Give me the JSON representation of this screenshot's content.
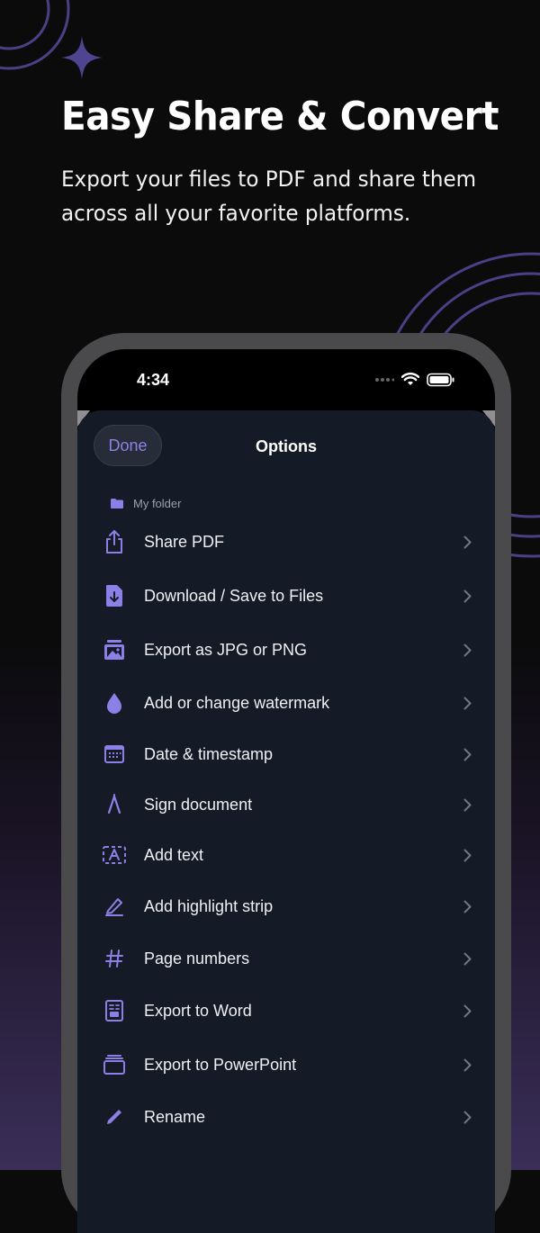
{
  "header": {
    "title": "Easy Share & Convert",
    "subtitle": "Export your files to PDF and share them across all your favorite platforms."
  },
  "status_bar": {
    "time": "4:34"
  },
  "sheet": {
    "done_label": "Done",
    "title": "Options",
    "folder_label": "My folder"
  },
  "menu": {
    "items": [
      {
        "label": "Share PDF",
        "icon": "share-icon"
      },
      {
        "label": "Download / Save to Files",
        "icon": "download-file-icon"
      },
      {
        "label": "Export as JPG or PNG",
        "icon": "image-icon"
      },
      {
        "label": "Add or change watermark",
        "icon": "drop-icon"
      },
      {
        "label": "Date & timestamp",
        "icon": "calendar-icon"
      },
      {
        "label": "Sign document",
        "icon": "signature-icon"
      },
      {
        "label": "Add text",
        "icon": "text-box-icon"
      },
      {
        "label": "Add highlight strip",
        "icon": "highlighter-icon"
      },
      {
        "label": "Page numbers",
        "icon": "hash-icon"
      },
      {
        "label": "Export to Word",
        "icon": "word-doc-icon"
      },
      {
        "label": "Export to PowerPoint",
        "icon": "slides-icon"
      },
      {
        "label": "Rename",
        "icon": "pencil-icon"
      }
    ]
  },
  "colors": {
    "accent": "#8b80e6",
    "background": "#0b0b0b",
    "sheet": "#151b26",
    "deco_ring": "#4b3f86"
  }
}
